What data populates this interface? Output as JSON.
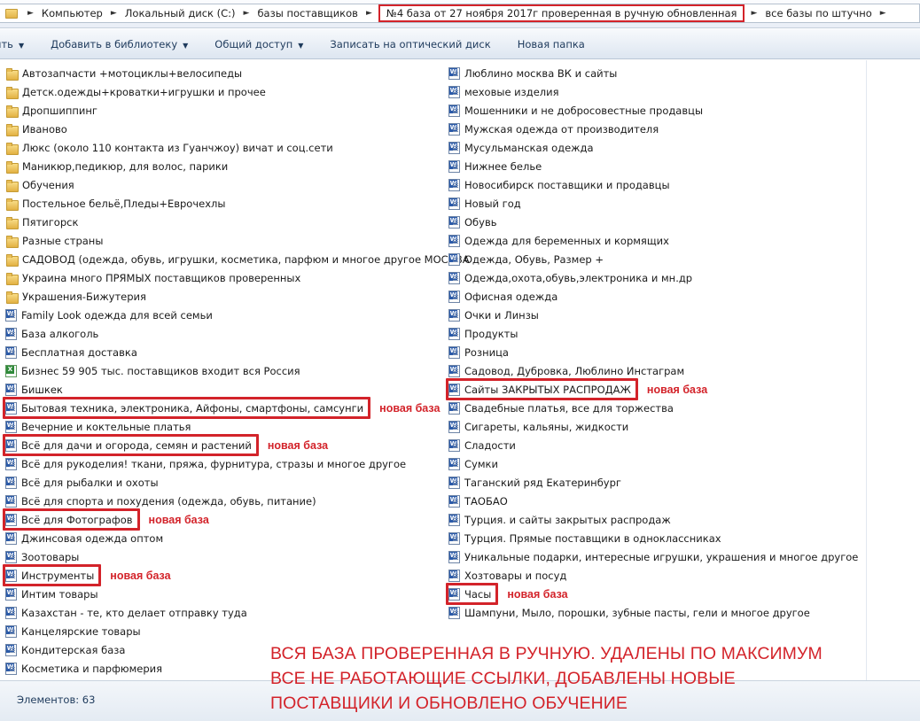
{
  "breadcrumb": [
    "Компьютер",
    "Локальный диск (C:)",
    "базы поставщиков",
    "№4 база от 27 ноября 2017г проверенная в ручную обновленная",
    "все базы по штучно"
  ],
  "toolbar": {
    "organize": "ить",
    "library": "Добавить в библиотеку",
    "share": "Общий доступ",
    "burn": "Записать на оптический диск",
    "new_folder": "Новая папка"
  },
  "new_tag": "новая база",
  "left_items": [
    {
      "name": "Автозапчасти +мотоциклы+велосипеды",
      "icon": "folder"
    },
    {
      "name": "Детск.одежды+кроватки+игрушки и прочее",
      "icon": "folder"
    },
    {
      "name": "Дропшиппинг",
      "icon": "folder"
    },
    {
      "name": "Иваново",
      "icon": "folder"
    },
    {
      "name": "Люкс (около 110 контакта из Гуанчжоу) вичат и соц.сети",
      "icon": "folder"
    },
    {
      "name": "Маникюр,педикюр, для волос, парики",
      "icon": "folder"
    },
    {
      "name": "Обучения",
      "icon": "folder"
    },
    {
      "name": "Постельное бельё,Пледы+Еврочехлы",
      "icon": "folder"
    },
    {
      "name": "Пятигорск",
      "icon": "folder"
    },
    {
      "name": "Разные страны",
      "icon": "folder"
    },
    {
      "name": "САДОВОД (одежда, обувь, игрушки, косметика, парфюм и многое другое МОСКВА",
      "icon": "folder"
    },
    {
      "name": "Украина много ПРЯМЫХ поставщиков проверенных",
      "icon": "folder"
    },
    {
      "name": "Украшения-Бижутерия",
      "icon": "folder"
    },
    {
      "name": "Family Look  одежда для всей семьи",
      "icon": "word"
    },
    {
      "name": "База алкоголь",
      "icon": "word"
    },
    {
      "name": "Бесплатная доставка",
      "icon": "word"
    },
    {
      "name": "Бизнес 59 905 тыс. поставщиков входит вся Россия",
      "icon": "excel"
    },
    {
      "name": "Бишкек",
      "icon": "word"
    },
    {
      "name": "Бытовая техника, электроника, Айфоны, смартфоны, самсунги",
      "icon": "word",
      "is_new": true
    },
    {
      "name": "Вечерние и коктельные платья",
      "icon": "word"
    },
    {
      "name": "Всё для дачи и огорода, семян и растений",
      "icon": "word",
      "is_new": true
    },
    {
      "name": "Всё для рукоделия! ткани, пряжа, фурнитура, стразы и многое другое",
      "icon": "word"
    },
    {
      "name": "Всё для рыбалки и охоты",
      "icon": "word"
    },
    {
      "name": "Всё для спорта и похудения (одежда, обувь, питание)",
      "icon": "word"
    },
    {
      "name": "Всё для Фотографов",
      "icon": "word",
      "is_new": true
    },
    {
      "name": "Джинсовая одежда оптом",
      "icon": "word"
    },
    {
      "name": "Зоотовары",
      "icon": "word"
    },
    {
      "name": "Инструменты",
      "icon": "word",
      "is_new": true
    },
    {
      "name": "Интим товары",
      "icon": "word"
    },
    {
      "name": "Казахстан - те, кто делает отправку туда",
      "icon": "word"
    },
    {
      "name": "Канцелярские товары",
      "icon": "word"
    },
    {
      "name": "Кондитерская база",
      "icon": "word"
    },
    {
      "name": "Косметика и парфюмерия",
      "icon": "word"
    }
  ],
  "right_items": [
    {
      "name": "Люблино москва  ВК и сайты",
      "icon": "word"
    },
    {
      "name": "меховые изделия",
      "icon": "word"
    },
    {
      "name": "Мошенники и не добросовестные продавцы",
      "icon": "word"
    },
    {
      "name": "Мужская одежда от производителя",
      "icon": "word"
    },
    {
      "name": "Мусульманская одежда",
      "icon": "word"
    },
    {
      "name": "Нижнее белье",
      "icon": "word"
    },
    {
      "name": "Новосибирск поставщики и продавцы",
      "icon": "word"
    },
    {
      "name": "Новый год",
      "icon": "word"
    },
    {
      "name": "Обувь",
      "icon": "word"
    },
    {
      "name": "Одежда для беременных и кормящих",
      "icon": "word"
    },
    {
      "name": "Одежда, Обувь, Размер +",
      "icon": "word"
    },
    {
      "name": "Одежда,охота,обувь,электроника и мн.др",
      "icon": "word"
    },
    {
      "name": "Офисная одежда",
      "icon": "word"
    },
    {
      "name": "Очки и Линзы",
      "icon": "word"
    },
    {
      "name": "Продукты",
      "icon": "word"
    },
    {
      "name": "Розница",
      "icon": "word"
    },
    {
      "name": "Садовод, Дубровка, Люблино Инстаграм",
      "icon": "word"
    },
    {
      "name": "Сайты ЗАКРЫТЫХ РАСПРОДАЖ",
      "icon": "word",
      "is_new": true
    },
    {
      "name": "Свадебные платья, все для торжества",
      "icon": "word"
    },
    {
      "name": "Сигареты, кальяны, жидкости",
      "icon": "word"
    },
    {
      "name": "Сладости",
      "icon": "word"
    },
    {
      "name": "Сумки",
      "icon": "word"
    },
    {
      "name": "Таганский ряд Екатеринбург",
      "icon": "word"
    },
    {
      "name": "ТАОБАО",
      "icon": "word"
    },
    {
      "name": "Турция. и сайты закрытых распродаж",
      "icon": "word"
    },
    {
      "name": "Турция. Прямые поставщики в одноклассниках",
      "icon": "word"
    },
    {
      "name": "Уникальные подарки, интересные игрушки, украшения и многое другое",
      "icon": "word"
    },
    {
      "name": "Хозтовары и посуд",
      "icon": "word"
    },
    {
      "name": "Часы",
      "icon": "word",
      "is_new": true
    },
    {
      "name": "Шампуни, Мыло, порошки, зубные пасты, гели и многое другое",
      "icon": "word"
    }
  ],
  "status": {
    "count": "Элементов: 63"
  },
  "notice": [
    "ВСЯ БАЗА ПРОВЕРЕННАЯ В РУЧНУЮ. УДАЛЕНЫ ПО МАКСИМУМ",
    "ВСЕ НЕ РАБОТАЮЩИЕ ССЫЛКИ, ДОБАВЛЕНЫ НОВЫЕ",
    "ПОСТАВЩИКИ И ОБНОВЛЕНО ОБУЧЕНИЕ"
  ],
  "colors": {
    "accent_red": "#d3232a",
    "toolbar_text": "#1e3a5c"
  }
}
